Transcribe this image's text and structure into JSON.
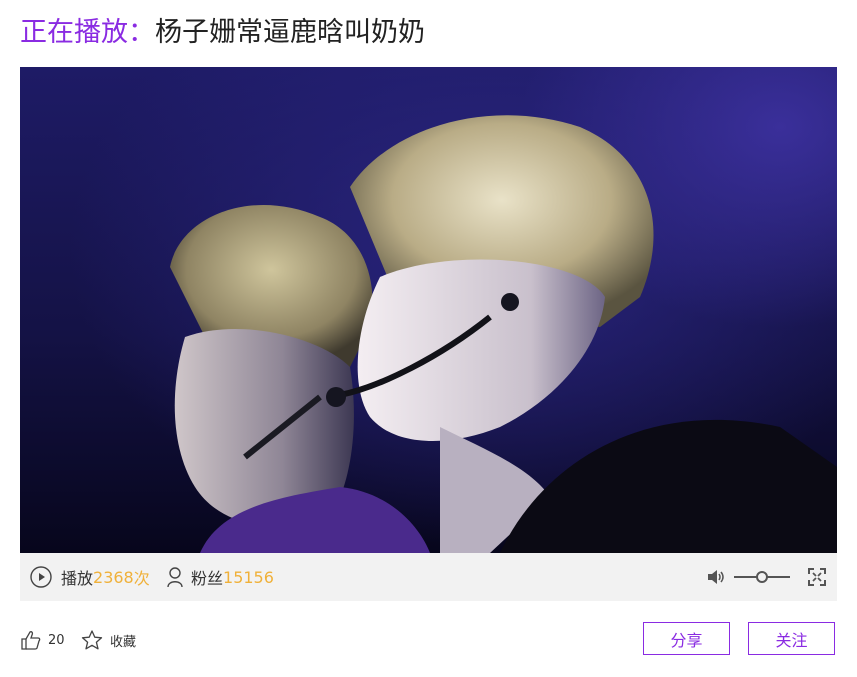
{
  "header": {
    "prefix": "正在播放：",
    "title": "杨子姗常逼鹿晗叫奶奶"
  },
  "stats": {
    "play_label": "播放",
    "play_count": "2368",
    "play_unit": "次",
    "fans_label": "粉丝",
    "fans_count": "15156"
  },
  "player": {
    "volume_level": 0.5
  },
  "actions": {
    "like_count": "20",
    "favorite_label": "收藏",
    "share_label": "分享",
    "follow_label": "关注"
  },
  "icons": [
    "play-circle-icon",
    "user-icon",
    "volume-icon",
    "fullscreen-icon",
    "thumbs-up-icon",
    "star-icon"
  ],
  "colors": {
    "accent": "#8a2be2",
    "count": "#f0b13a",
    "control_bar": "#f2f2f2"
  }
}
